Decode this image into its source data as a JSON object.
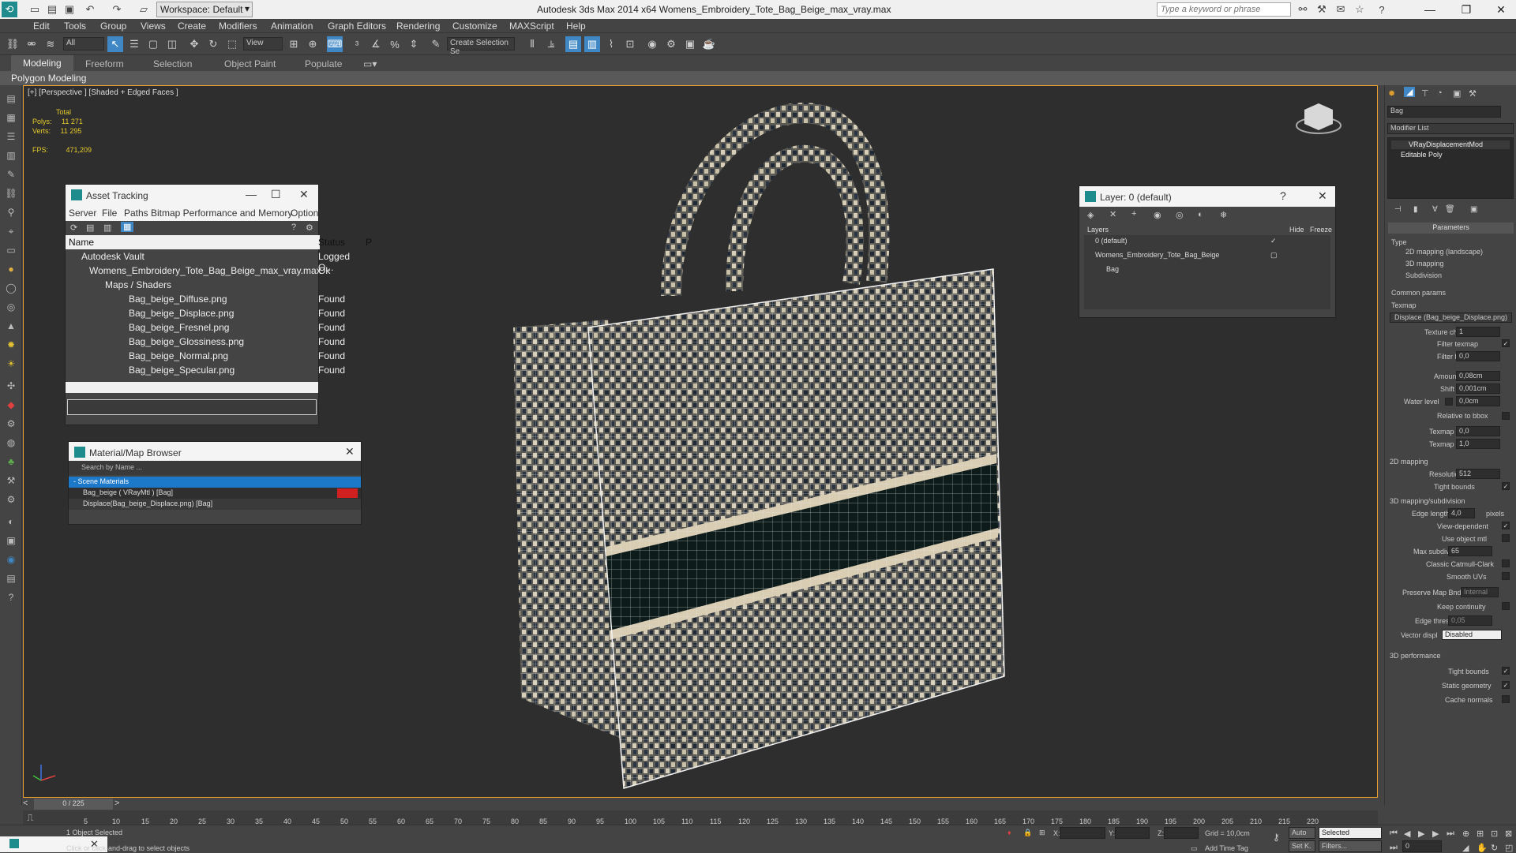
{
  "title": "Autodesk 3ds Max  2014 x64     Womens_Embroidery_Tote_Bag_Beige_max_vray.max",
  "workspace": "Workspace: Default",
  "keyword_placeholder": "Type a keyword or phrase",
  "menu": [
    "Edit",
    "Tools",
    "Group",
    "Views",
    "Create",
    "Modifiers",
    "Animation",
    "Graph Editors",
    "Rendering",
    "Customize",
    "MAXScript",
    "Help"
  ],
  "toolbar": {
    "filter": "All",
    "view": "View",
    "selection_set": "Create Selection Se"
  },
  "ribbon": {
    "tabs": [
      "Modeling",
      "Freeform",
      "Selection",
      "Object Paint",
      "Populate"
    ],
    "sub": "Polygon Modeling"
  },
  "viewport": {
    "label": "[+] [Perspective ] [Shaded + Edged Faces ]",
    "stats": {
      "total": "Total",
      "polys_label": "Polys:",
      "polys": "11 271",
      "verts_label": "Verts:",
      "verts": "11 295",
      "fps_label": "FPS:",
      "fps": "471,209"
    }
  },
  "asset_tracking": {
    "title": "Asset Tracking",
    "menu": [
      "Server",
      "File",
      "Paths",
      "Bitmap Performance and Memory",
      "Options"
    ],
    "cols": [
      "Name",
      "Status",
      "P"
    ],
    "rows": [
      {
        "name": "Autodesk Vault",
        "status": "Logged O..."
      },
      {
        "name": "Womens_Embroidery_Tote_Bag_Beige_max_vray.max",
        "status": "Ok"
      },
      {
        "name": "Maps / Shaders",
        "status": ""
      },
      {
        "name": "Bag_beige_Diffuse.png",
        "status": "Found"
      },
      {
        "name": "Bag_beige_Displace.png",
        "status": "Found"
      },
      {
        "name": "Bag_beige_Fresnel.png",
        "status": "Found"
      },
      {
        "name": "Bag_beige_Glossiness.png",
        "status": "Found"
      },
      {
        "name": "Bag_beige_Normal.png",
        "status": "Found"
      },
      {
        "name": "Bag_beige_Specular.png",
        "status": "Found"
      }
    ]
  },
  "material_browser": {
    "title": "Material/Map Browser",
    "search": "Search by Name ...",
    "group": "- Scene Materials",
    "items": [
      "Bag_beige  ( VRayMtl ) [Bag]",
      "Displace(Bag_beige_Displace.png) [Bag]"
    ]
  },
  "layer_dialog": {
    "title": "Layer: 0 (default)",
    "cols": [
      "Layers",
      "Hide",
      "Freeze"
    ],
    "rows": [
      "0 (default)",
      "Womens_Embroidery_Tote_Bag_Beige",
      "Bag"
    ]
  },
  "command_panel": {
    "object_name": "Bag",
    "modifier_list": "Modifier List",
    "stack": [
      "VRayDisplacementMod",
      "Editable Poly"
    ],
    "rollout": "Parameters",
    "type_label": "Type",
    "type_options": [
      "2D mapping (landscape)",
      "3D mapping",
      "Subdivision"
    ],
    "common": "Common params",
    "texmap_label": "Texmap",
    "texmap": "Displace (Bag_beige_Displace.png)",
    "fields": [
      {
        "label": "Texture chan",
        "value": "1"
      },
      {
        "label": "Filter texmap",
        "value": ""
      },
      {
        "label": "Filter blur",
        "value": "0,0"
      },
      {
        "label": "Amount",
        "value": "0,08cm"
      },
      {
        "label": "Shift",
        "value": "0,001cm"
      },
      {
        "label": "Water level",
        "value": "0,0cm"
      },
      {
        "label": "Relative to bbox",
        "value": ""
      },
      {
        "label": "Texmap min",
        "value": "0,0"
      },
      {
        "label": "Texmap max",
        "value": "1,0"
      }
    ],
    "sec_2d": "2D mapping",
    "resolution_label": "Resolution",
    "resolution": "512",
    "tight_bounds": "Tight bounds",
    "sec_3d": "3D mapping/subdivision",
    "edge_length_label": "Edge length",
    "edge_length": "4,0",
    "pixels": "pixels",
    "view_dependent": "View-dependent",
    "use_object_mtl": "Use object mtl",
    "max_subdivs_label": "Max subdivs",
    "max_subdivs": "65",
    "classic": "Classic Catmull-Clark",
    "smooth_uvs": "Smooth UVs",
    "preserve_map": "Preserve Map Bnd",
    "preserve_val": "Internal",
    "keep_continuity": "Keep continuity",
    "edge_thresh_label": "Edge thresh",
    "edge_thresh": "0,05",
    "vector_disp_label": "Vector displ",
    "vector_disp": "Disabled",
    "sec_perf": "3D performance",
    "perf": [
      "Tight bounds",
      "Static geometry",
      "Cache normals"
    ]
  },
  "timeline": {
    "frame": "0 / 225"
  },
  "ruler_ticks": [
    "5",
    "10",
    "15",
    "20",
    "25",
    "30",
    "35",
    "40",
    "45",
    "50",
    "55",
    "60",
    "65",
    "70",
    "75",
    "80",
    "85",
    "90",
    "95",
    "100",
    "105",
    "110",
    "115",
    "120",
    "125",
    "130",
    "135",
    "140",
    "145",
    "150",
    "155",
    "160",
    "165",
    "170",
    "175",
    "180",
    "185",
    "190",
    "195",
    "200",
    "205",
    "210",
    "215",
    "220"
  ],
  "status": {
    "objects": "1 Object Selected",
    "prompt": "Click or click-and-drag to select objects",
    "grid": "Grid = 10,0cm",
    "add_time_tag": "Add Time Tag",
    "auto": "Auto",
    "selected": "Selected",
    "setk": "Set K.",
    "filters": "Filters...",
    "frame": "0",
    "x": "X:",
    "y": "Y:",
    "z": "Z:"
  }
}
